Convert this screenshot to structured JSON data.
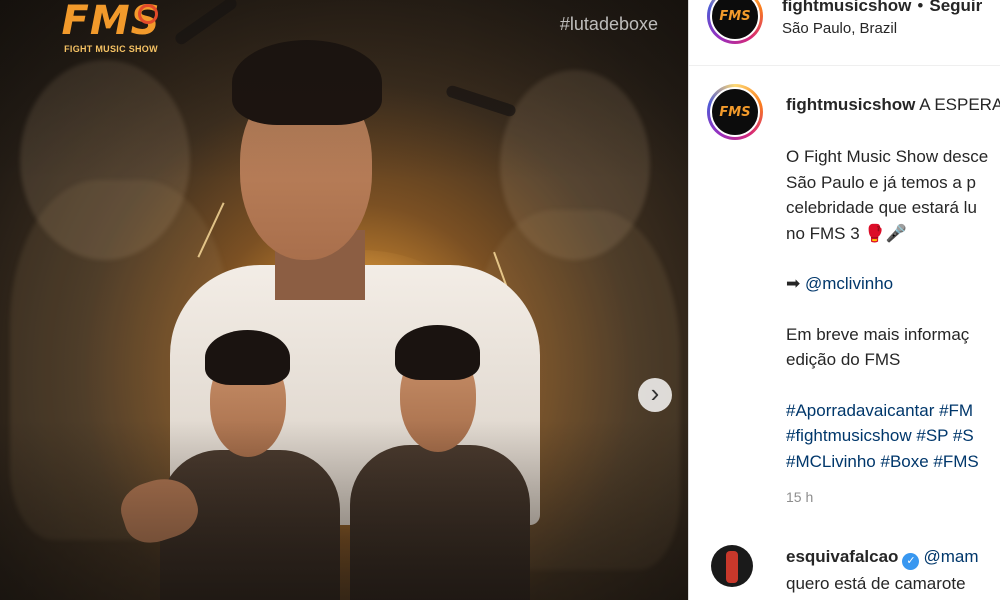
{
  "post": {
    "logo_text": "FMS",
    "logo_subtitle": "FIGHT MUSIC SHOW",
    "hashtag_overlay": "#lutadeboxe",
    "next_icon": "chevron-right-icon"
  },
  "header": {
    "username": "fightmusicshow",
    "separator": "•",
    "follow_label": "Seguir",
    "location": "São Paulo, Brazil"
  },
  "caption": {
    "username": "fightmusicshow",
    "lead": "A ESPERA",
    "paragraph1": [
      "O Fight Music Show desce",
      "São Paulo e já temos a p",
      "celebridade que estará lu",
      "no FMS 3 🥊🎤"
    ],
    "mention_arrow": "➡",
    "mention": "@mclivinho",
    "paragraph3": [
      "Em breve mais informaç",
      "edição do FMS"
    ],
    "hashtag_lines": [
      "#Aporradavaicantar #FM",
      "#fightmusicshow #SP #S",
      "#MCLivinho #Boxe #FMS"
    ],
    "timestamp": "15 h"
  },
  "comment": {
    "username": "esquivafalcao",
    "verified_icon": "verified-badge-icon",
    "mention": "@mam",
    "line2": "quero está de camarote"
  },
  "colors": {
    "brand_orange": "#f29a2b",
    "link_blue": "#00376b",
    "verified_blue": "#3897f0"
  }
}
